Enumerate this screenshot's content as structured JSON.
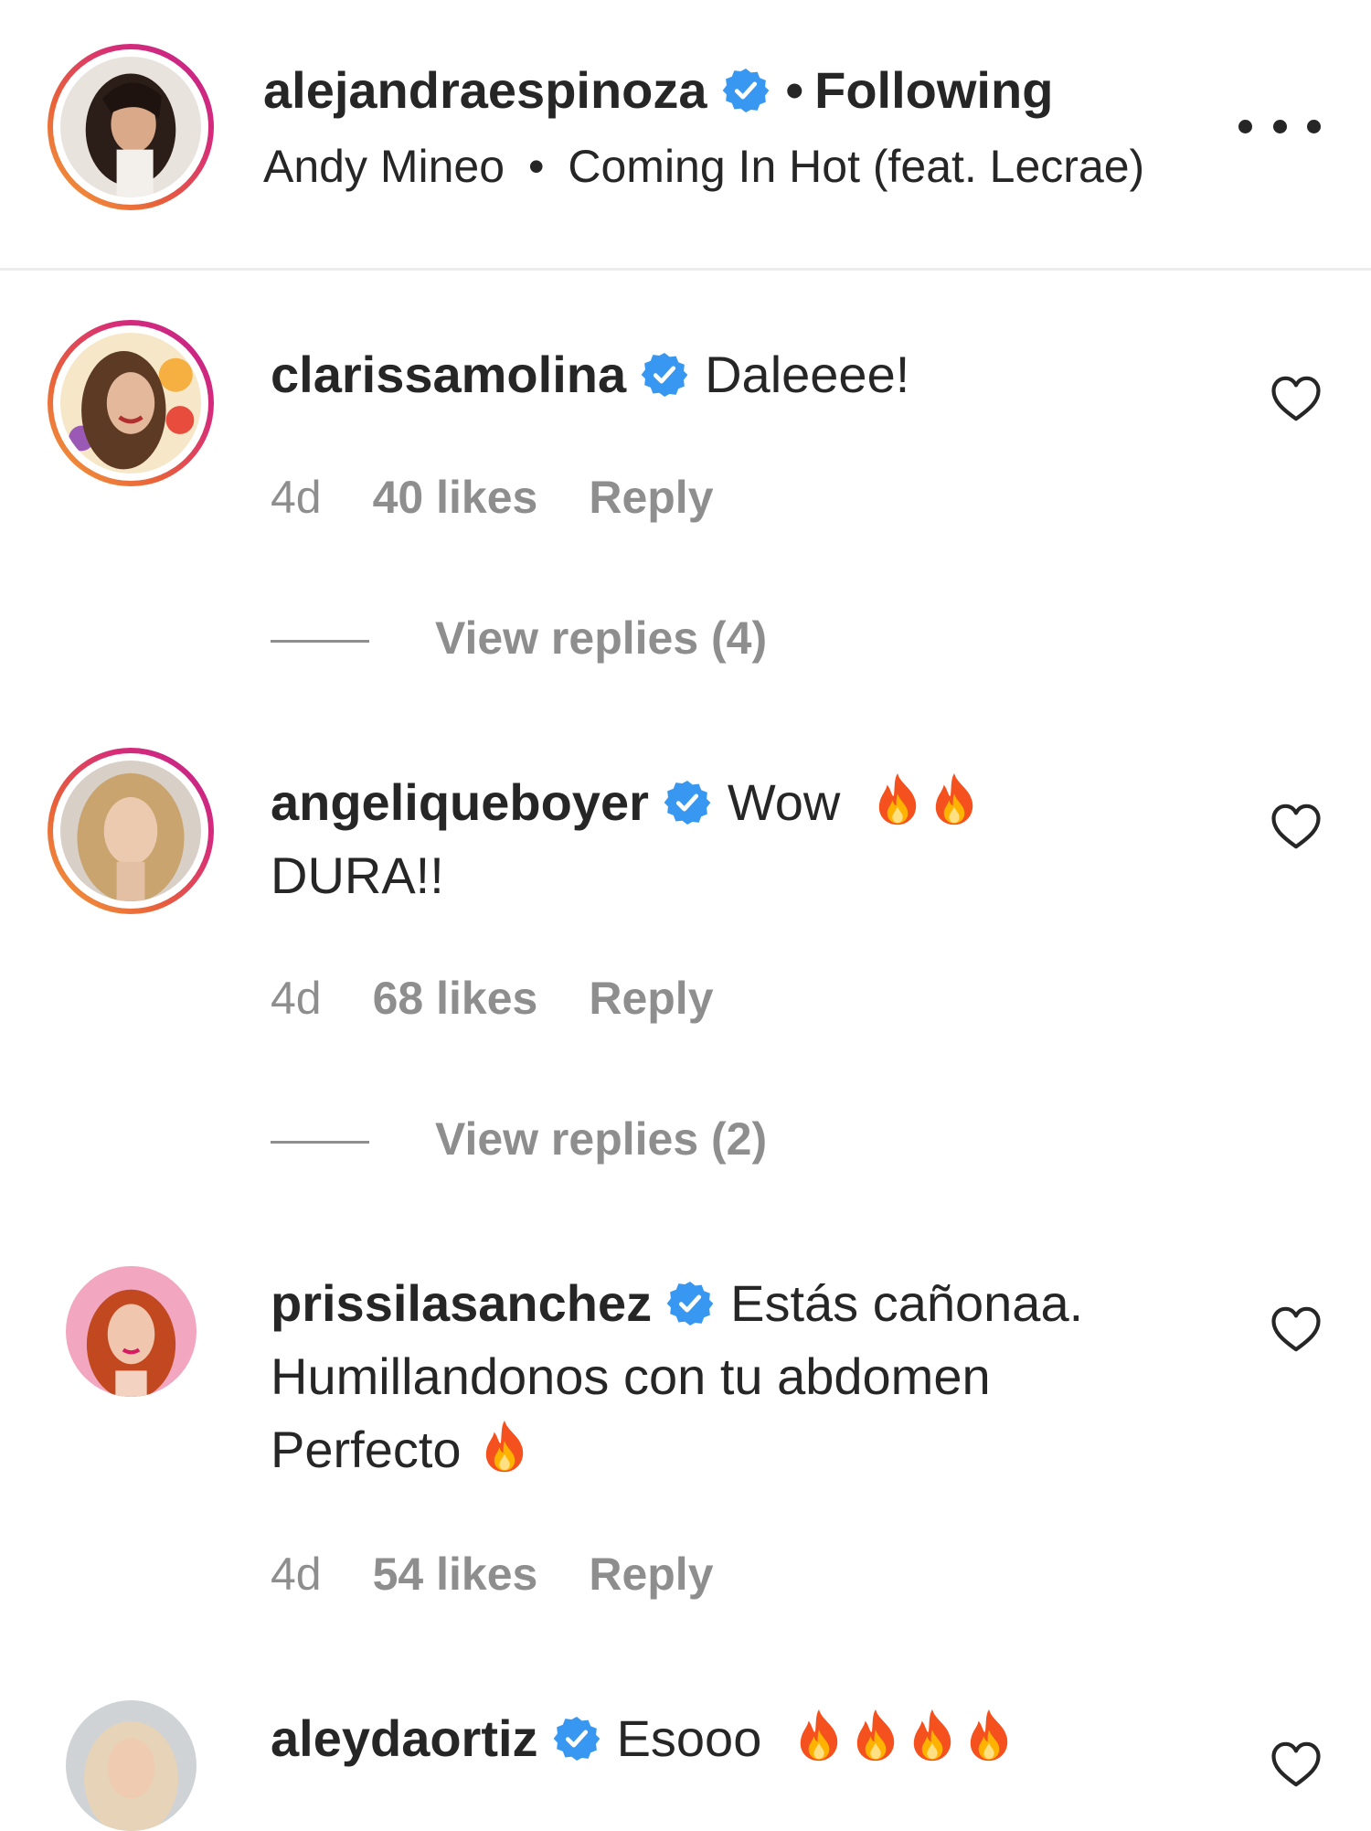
{
  "header": {
    "username": "alejandraespinoza",
    "dot": "•",
    "follow_status": "Following",
    "music_artist": "Andy Mineo",
    "music_sep": "•",
    "music_title": "Coming In Hot (feat. Lecrae)"
  },
  "comments": [
    {
      "username": "clarissamolina",
      "text": "Daleeee!",
      "text_line2": "",
      "text_line3": "",
      "time": "4d",
      "likes": "40 likes",
      "reply": "Reply",
      "view_replies": "View replies (4)"
    },
    {
      "username": "angeliqueboyer",
      "text": "Wow",
      "text_line2": "DURA!!",
      "text_line3": "",
      "time": "4d",
      "likes": "68 likes",
      "reply": "Reply",
      "view_replies": "View replies (2)"
    },
    {
      "username": "prissilasanchez",
      "text": "Estás cañonaa.",
      "text_line2": "Humillandonos con tu abdomen",
      "text_line3": "Perfecto",
      "time": "4d",
      "likes": "54 likes",
      "reply": "Reply",
      "view_replies": ""
    },
    {
      "username": "aleydaortiz",
      "text": "Esooo",
      "text_line2": "",
      "text_line3": "",
      "time": "",
      "likes": "",
      "reply": "",
      "view_replies": ""
    }
  ],
  "colors": {
    "verified_badge": "#3897f0",
    "meta_text": "#8e8e8e",
    "primary_text": "#262626",
    "story_ring_start": "#f4a23a",
    "story_ring_end": "#c0218d"
  },
  "icons": {
    "verified": "verified-badge-icon",
    "like": "heart-outline-icon",
    "more": "more-options-icon",
    "emoji": "fire-emoji-icon"
  }
}
